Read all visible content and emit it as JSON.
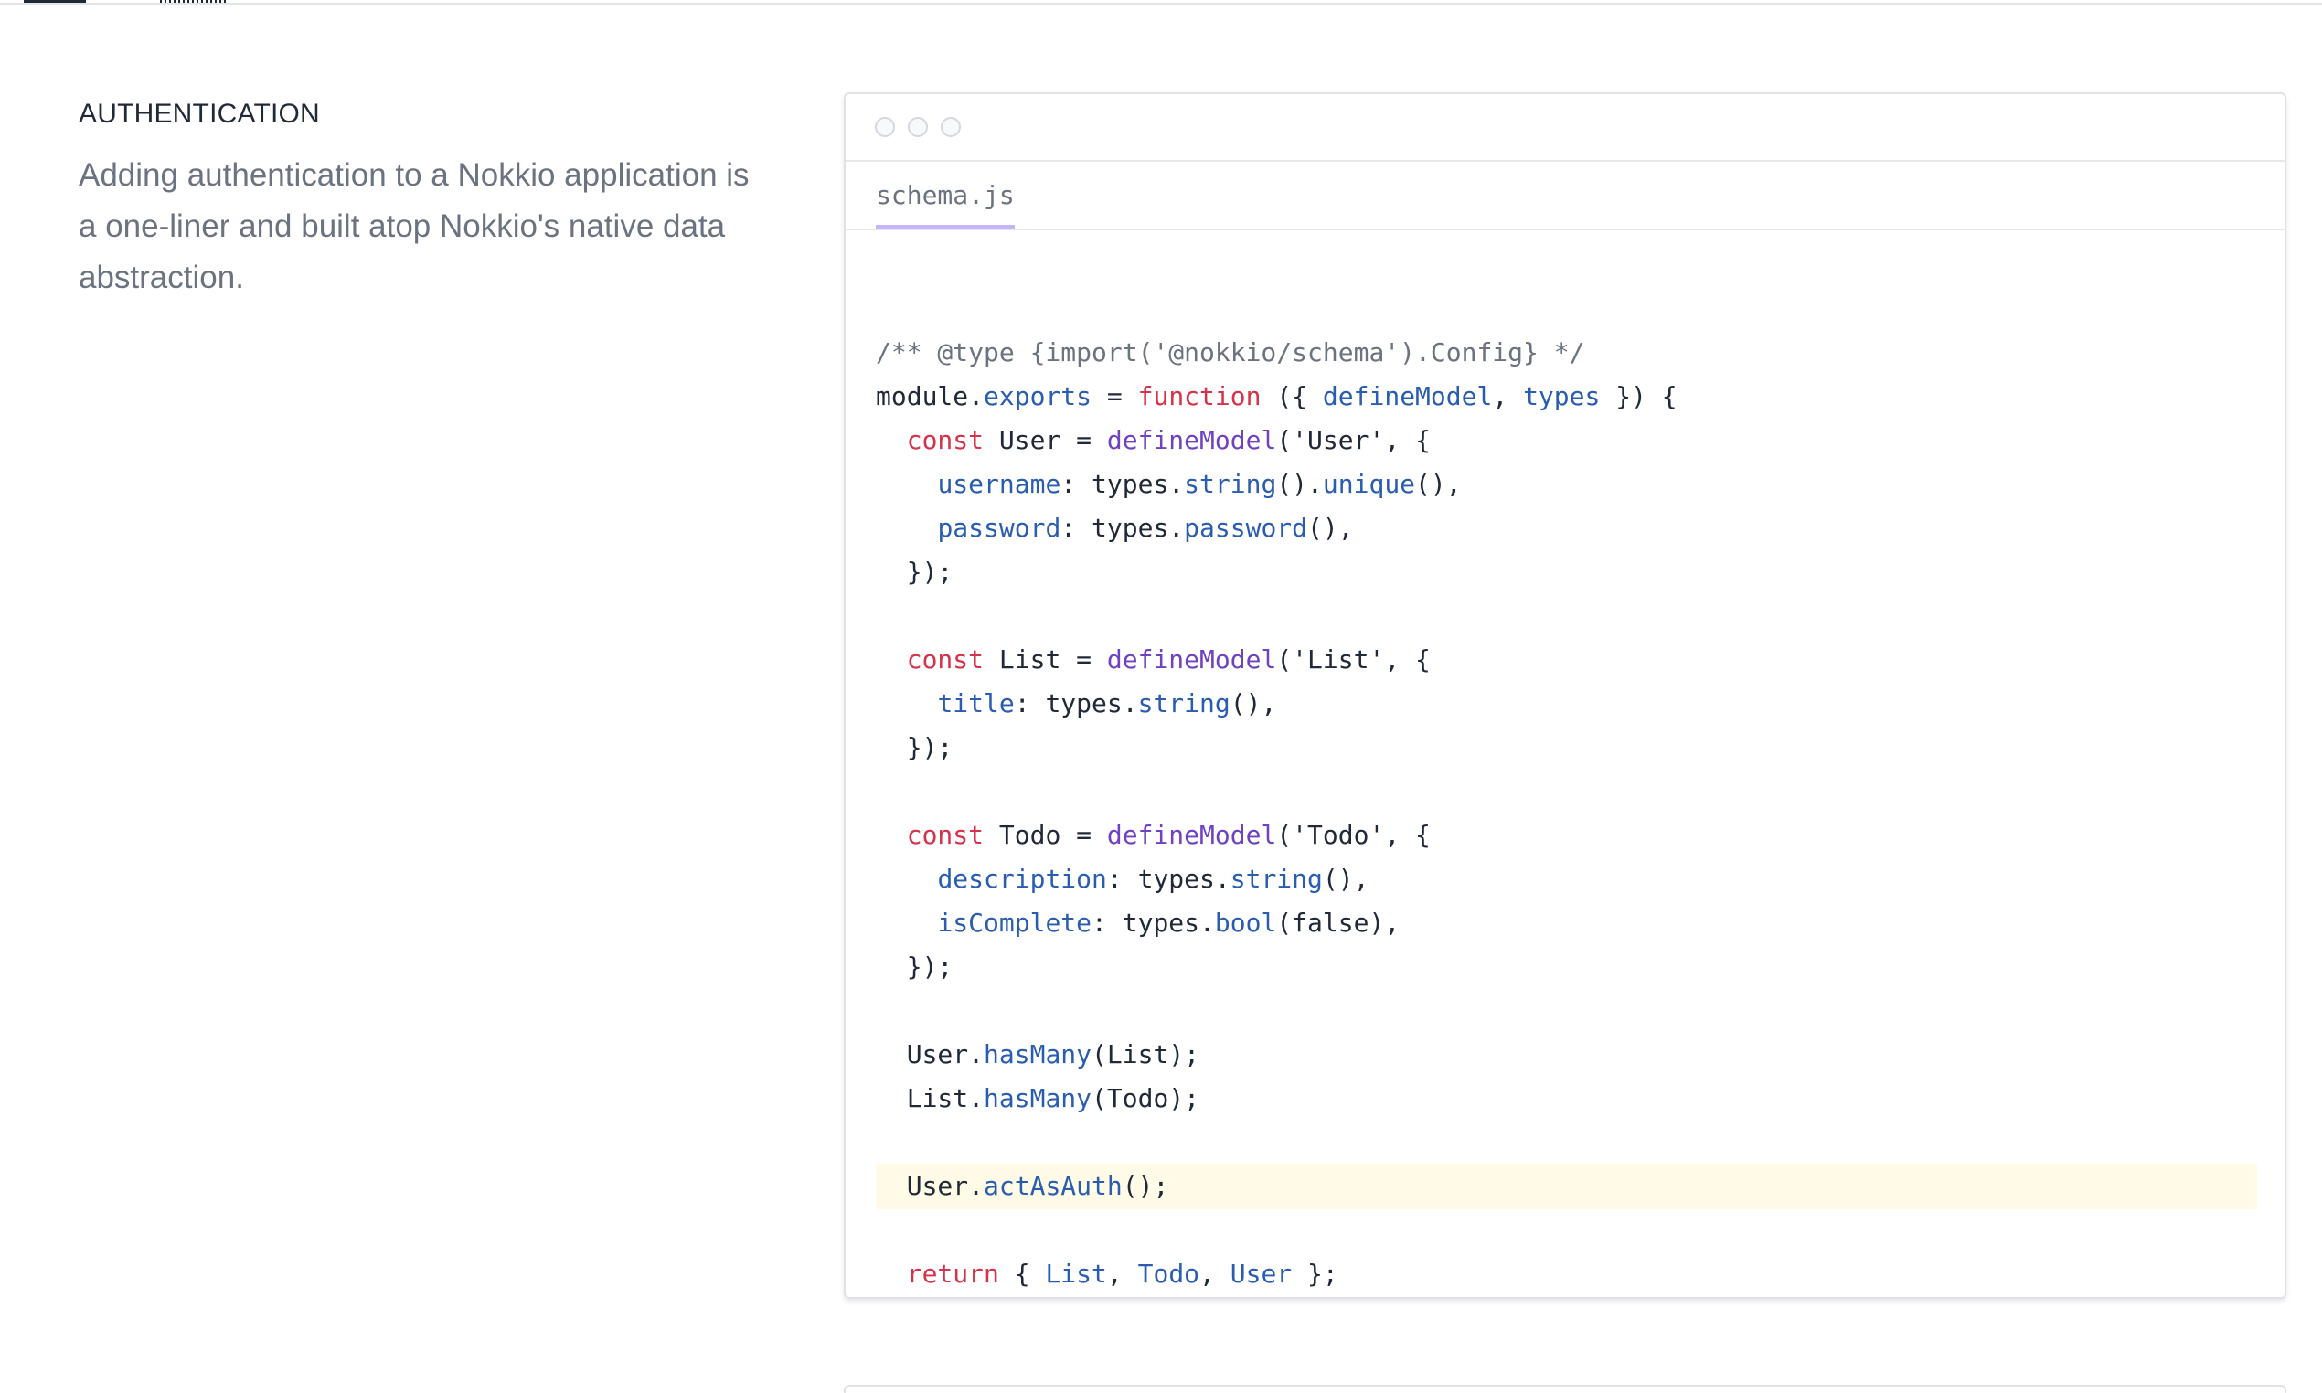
{
  "section": {
    "title": "AUTHENTICATION",
    "description": "Adding authentication to a Nokkio application is a one-liner and built atop Nokkio's native data abstraction."
  },
  "code_window": {
    "tab_label": "schema.js",
    "highlight_color": "#fffbe6",
    "tab_accent_color": "#c4b5fd",
    "lines": [
      [
        [
          "comment",
          "/** @type {import('@nokkio/schema').Config} */"
        ]
      ],
      [
        [
          "default",
          "module."
        ],
        [
          "prop",
          "exports"
        ],
        [
          "default",
          " = "
        ],
        [
          "keyword",
          "function"
        ],
        [
          "default",
          " ({ "
        ],
        [
          "prop",
          "defineModel"
        ],
        [
          "default",
          ", "
        ],
        [
          "prop",
          "types"
        ],
        [
          "default",
          " }) {"
        ]
      ],
      [
        [
          "default",
          "  "
        ],
        [
          "keyword",
          "const"
        ],
        [
          "default",
          " User = "
        ],
        [
          "func",
          "defineModel"
        ],
        [
          "default",
          "('User', {"
        ]
      ],
      [
        [
          "default",
          "    "
        ],
        [
          "prop",
          "username"
        ],
        [
          "default",
          ": types."
        ],
        [
          "prop",
          "string"
        ],
        [
          "default",
          "()."
        ],
        [
          "prop",
          "unique"
        ],
        [
          "default",
          "(),"
        ]
      ],
      [
        [
          "default",
          "    "
        ],
        [
          "prop",
          "password"
        ],
        [
          "default",
          ": types."
        ],
        [
          "prop",
          "password"
        ],
        [
          "default",
          "(),"
        ]
      ],
      [
        [
          "default",
          "  });"
        ]
      ],
      [
        [
          "default",
          ""
        ]
      ],
      [
        [
          "default",
          "  "
        ],
        [
          "keyword",
          "const"
        ],
        [
          "default",
          " List = "
        ],
        [
          "func",
          "defineModel"
        ],
        [
          "default",
          "('List', {"
        ]
      ],
      [
        [
          "default",
          "    "
        ],
        [
          "prop",
          "title"
        ],
        [
          "default",
          ": types."
        ],
        [
          "prop",
          "string"
        ],
        [
          "default",
          "(),"
        ]
      ],
      [
        [
          "default",
          "  });"
        ]
      ],
      [
        [
          "default",
          ""
        ]
      ],
      [
        [
          "default",
          "  "
        ],
        [
          "keyword",
          "const"
        ],
        [
          "default",
          " Todo = "
        ],
        [
          "func",
          "defineModel"
        ],
        [
          "default",
          "('Todo', {"
        ]
      ],
      [
        [
          "default",
          "    "
        ],
        [
          "prop",
          "description"
        ],
        [
          "default",
          ": types."
        ],
        [
          "prop",
          "string"
        ],
        [
          "default",
          "(),"
        ]
      ],
      [
        [
          "default",
          "    "
        ],
        [
          "prop",
          "isComplete"
        ],
        [
          "default",
          ": types."
        ],
        [
          "prop",
          "bool"
        ],
        [
          "default",
          "(false),"
        ]
      ],
      [
        [
          "default",
          "  });"
        ]
      ],
      [
        [
          "default",
          ""
        ]
      ],
      [
        [
          "default",
          "  User."
        ],
        [
          "prop",
          "hasMany"
        ],
        [
          "default",
          "(List);"
        ]
      ],
      [
        [
          "default",
          "  List."
        ],
        [
          "prop",
          "hasMany"
        ],
        [
          "default",
          "(Todo);"
        ]
      ],
      [
        [
          "default",
          ""
        ]
      ],
      [
        [
          "default",
          "  User."
        ],
        [
          "prop",
          "actAsAuth"
        ],
        [
          "default",
          "();"
        ]
      ],
      [
        [
          "default",
          ""
        ]
      ],
      [
        [
          "default",
          "  "
        ],
        [
          "keyword",
          "return"
        ],
        [
          "default",
          " { "
        ],
        [
          "prop",
          "List"
        ],
        [
          "default",
          ", "
        ],
        [
          "prop",
          "Todo"
        ],
        [
          "default",
          ", "
        ],
        [
          "prop",
          "User"
        ],
        [
          "default",
          " };"
        ]
      ],
      [
        [
          "default",
          "};"
        ]
      ]
    ],
    "highlighted_line": 19
  }
}
